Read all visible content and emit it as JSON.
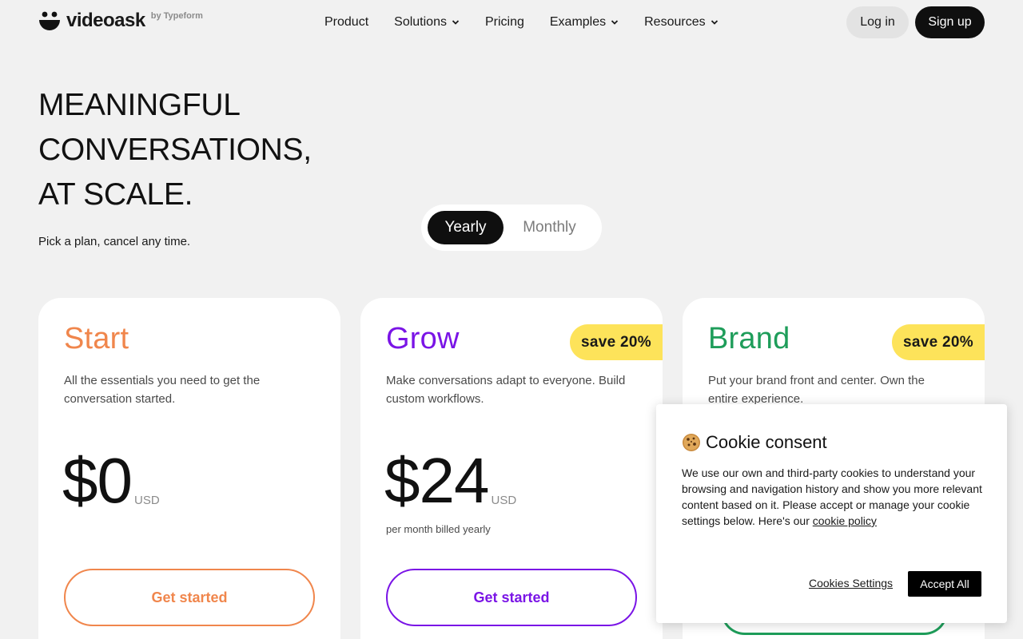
{
  "header": {
    "logo_word": "videoask",
    "logo_by": "by Typeform",
    "nav": [
      {
        "label": "Product",
        "dropdown": false
      },
      {
        "label": "Solutions",
        "dropdown": true
      },
      {
        "label": "Pricing",
        "dropdown": false
      },
      {
        "label": "Examples",
        "dropdown": true
      },
      {
        "label": "Resources",
        "dropdown": true
      }
    ],
    "login_label": "Log in",
    "signup_label": "Sign up"
  },
  "hero": {
    "title_lines": [
      "MEANINGFUL",
      "CONVERSATIONS,",
      "AT SCALE."
    ],
    "subtitle": "Pick a plan, cancel any time."
  },
  "billing_toggle": {
    "options": [
      "Yearly",
      "Monthly"
    ],
    "selected": "Yearly"
  },
  "plans": [
    {
      "name": "Start",
      "color": "#f0864c",
      "description": "All the essentials you need to get the conversation started.",
      "price": "$0",
      "currency": "USD",
      "billing_note": "",
      "badge": "",
      "cta": "Get started"
    },
    {
      "name": "Grow",
      "color": "#7a14e6",
      "description": "Make conversations adapt to everyone. Build custom workflows.",
      "price": "$24",
      "currency": "USD",
      "billing_note": "per month billed yearly",
      "badge": "save 20%",
      "cta": "Get started"
    },
    {
      "name": "Brand",
      "color": "#1e9d5a",
      "description": "Put your brand front and center. Own the entire experience.",
      "price": "",
      "currency": "",
      "billing_note": "",
      "badge": "save 20%",
      "cta": ""
    }
  ],
  "cookie": {
    "title": "Cookie consent",
    "text": "We use our own and third-party cookies to understand your browsing and navigation history and show you more relevant content based on it. Please accept or manage your cookie settings below. Here's our ",
    "link": "cookie policy",
    "settings_label": "Cookies Settings",
    "accept_label": "Accept All"
  }
}
